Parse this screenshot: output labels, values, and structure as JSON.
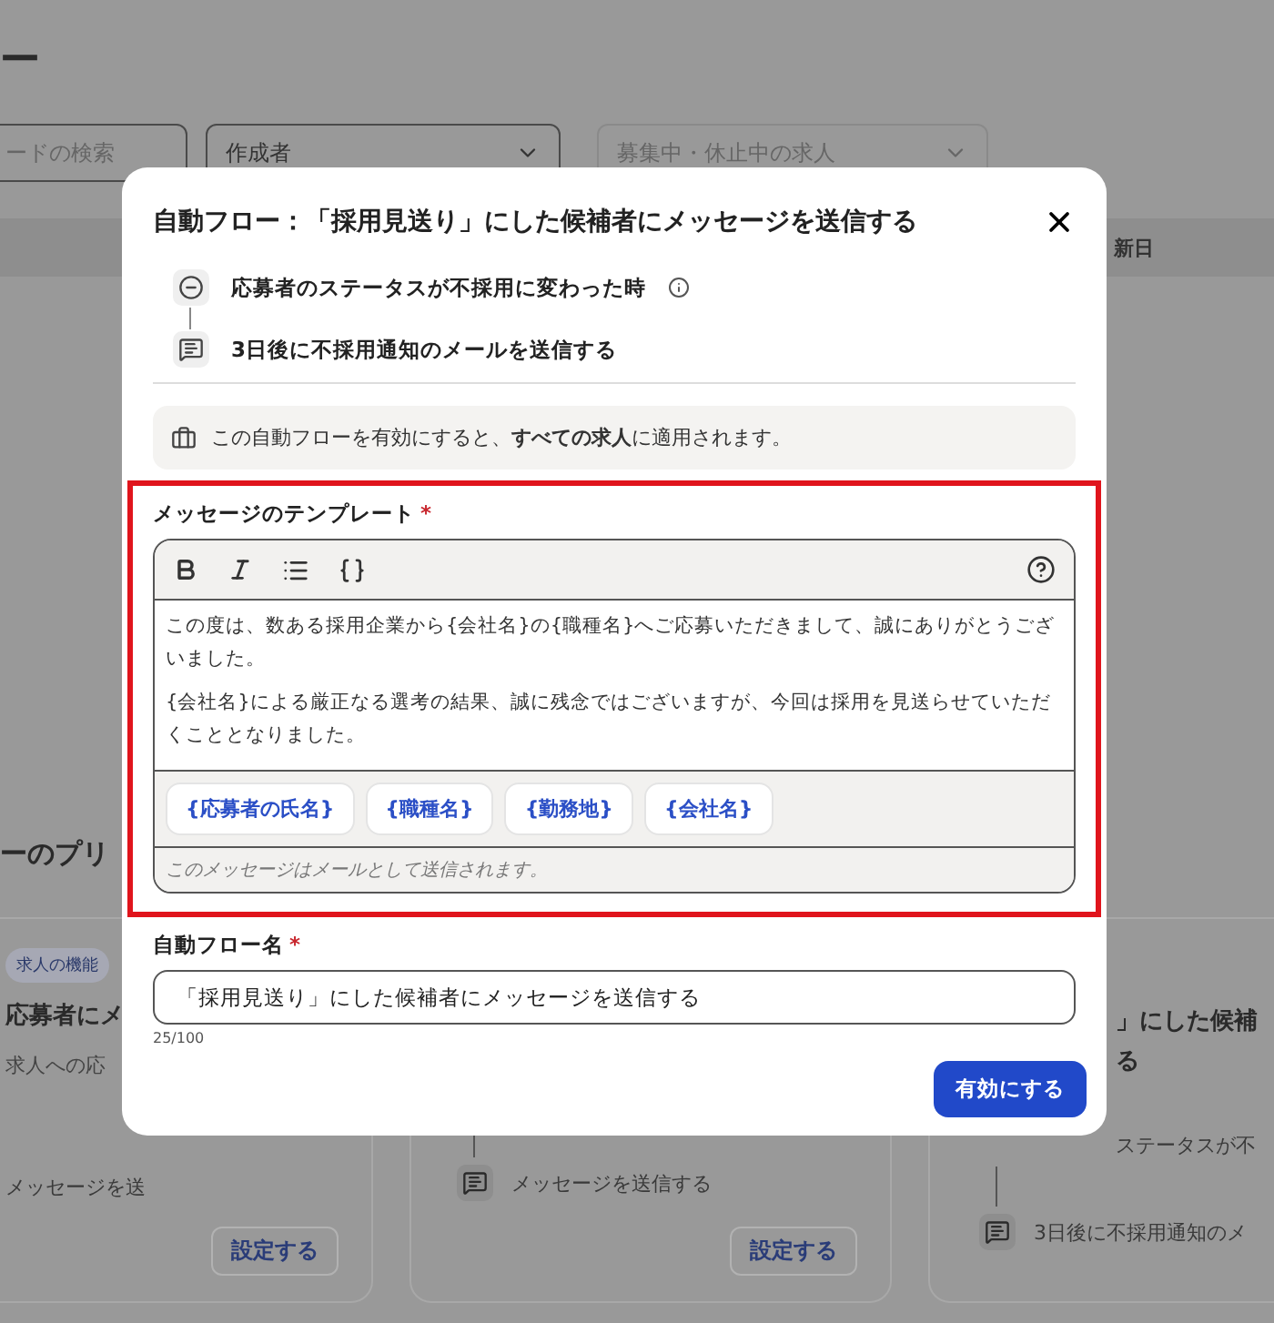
{
  "background": {
    "title": "ー",
    "search": {
      "placeholder": "ードの検索"
    },
    "filters": [
      {
        "label": "作成者",
        "kind": "value"
      },
      {
        "label": "募集中・休止中の求人",
        "kind": "placeholder"
      }
    ],
    "table": {
      "columns": [
        "新日"
      ]
    },
    "section_title": "ーのプリ",
    "cards": [
      {
        "clipped": false,
        "badge": "求人の機能",
        "title": [
          "応募者にメ"
        ],
        "description": "求人への応",
        "steps": [
          {
            "kind": "fragment",
            "text": "メッセージを送"
          }
        ],
        "button": "設定する"
      },
      {
        "steps": [
          {
            "kind": "message",
            "text": "メッセージを送信する"
          }
        ],
        "button": "設定する"
      },
      {
        "clipped": true,
        "title": [
          "」にした候補",
          "る"
        ],
        "steps": [
          {
            "kind": "fragment",
            "text": "ステータスが不"
          },
          {
            "kind": "message",
            "text": "3日後に不採用通知のメ"
          }
        ]
      }
    ]
  },
  "modal": {
    "title": "自動フロー：「採用見送り」にした候補者にメッセージを送信する",
    "flow": [
      {
        "kind": "trigger",
        "text": "応募者のステータスが不採用に変わった時",
        "info": true
      },
      {
        "kind": "message",
        "text": "3日後に不採用通知のメールを送信する",
        "info": false
      }
    ],
    "notice": "この自動フローを有効にすると、**すべての求人**に適用されます。",
    "template": {
      "label": "メッセージのテンプレート",
      "required_mark": "*",
      "toolbar": [
        {
          "kind": "bold"
        },
        {
          "kind": "italic"
        },
        {
          "kind": "list"
        },
        {
          "kind": "variable"
        }
      ],
      "paragraphs": [
        "この度は、数ある採用企業から{会社名}の{職種名}へご応募いただきまして、誠にありがとうございました。",
        "{会社名}による厳正なる選考の結果、誠に残念ではございますが、今回は採用を見送らせていただくこととなりました。"
      ],
      "variables": [
        "{応募者の氏名}",
        "{職種名}",
        "{勤務地}",
        "{会社名}"
      ],
      "footer": "このメッセージはメールとして送信されます。"
    },
    "name_field": {
      "label": "自動フロー名",
      "required_mark": "*",
      "value": "「採用見送り」にした候補者にメッセージを送信する",
      "counter": "25/100"
    },
    "submit": "有効にする"
  }
}
